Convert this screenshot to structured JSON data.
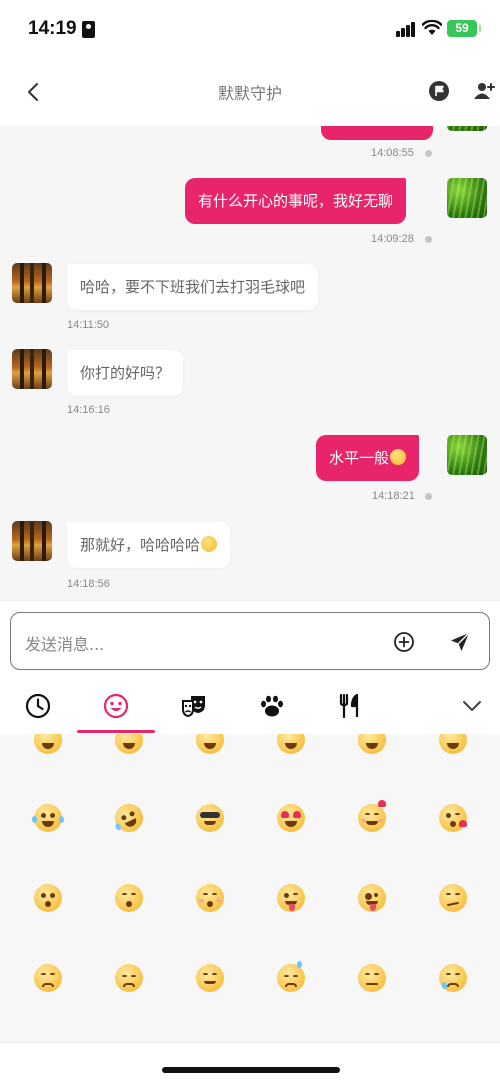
{
  "status_bar": {
    "time": "14:19",
    "battery": "59"
  },
  "header": {
    "title": "默默守护"
  },
  "messages": [
    {
      "side": "out",
      "text": "",
      "time": "14:08:55"
    },
    {
      "side": "out",
      "text": "有什么开心的事呢，我好无聊",
      "time": "14:09:28"
    },
    {
      "side": "in",
      "text": "哈哈，要不下班我们去打羽毛球吧",
      "time": "14:11:50"
    },
    {
      "side": "in",
      "text": "你打的好吗？",
      "time": "14:16:16"
    },
    {
      "side": "out",
      "text": "水平一般",
      "time": "14:18:21"
    },
    {
      "side": "in",
      "text": "那就好，哈哈哈哈",
      "time": "14:18:56"
    }
  ],
  "composer": {
    "placeholder": "发送消息..."
  },
  "emoji_tabs": [
    {
      "icon": "clock-icon",
      "active": false
    },
    {
      "icon": "smiley-icon",
      "active": true
    },
    {
      "icon": "masks-icon",
      "active": false
    },
    {
      "icon": "paw-icon",
      "active": false
    },
    {
      "icon": "fork-knife-icon",
      "active": false
    }
  ],
  "emoji_grid": [
    [
      "grinning-emoji",
      "grinning-emoji",
      "grinning-emoji",
      "grinning-emoji",
      "grinning-emoji",
      "grinning-emoji"
    ],
    [
      "tears-of-joy-emoji",
      "rofl-emoji",
      "sunglasses-emoji",
      "heart-eyes-emoji",
      "smiling-hearts-emoji",
      "kissing-heart-emoji"
    ],
    [
      "kissing-emoji",
      "kissing-smiling-eyes-emoji",
      "kissing-closed-eyes-emoji",
      "winking-tongue-emoji",
      "zany-emoji",
      "smirk-emoji"
    ],
    [
      "unamused-emoji",
      "disappointed-emoji",
      "relieved-emoji",
      "downcast-sweat-emoji",
      "confounded-emoji",
      "crying-emoji"
    ]
  ],
  "colors": {
    "accent": "#e8256b",
    "battery": "#37c759"
  }
}
